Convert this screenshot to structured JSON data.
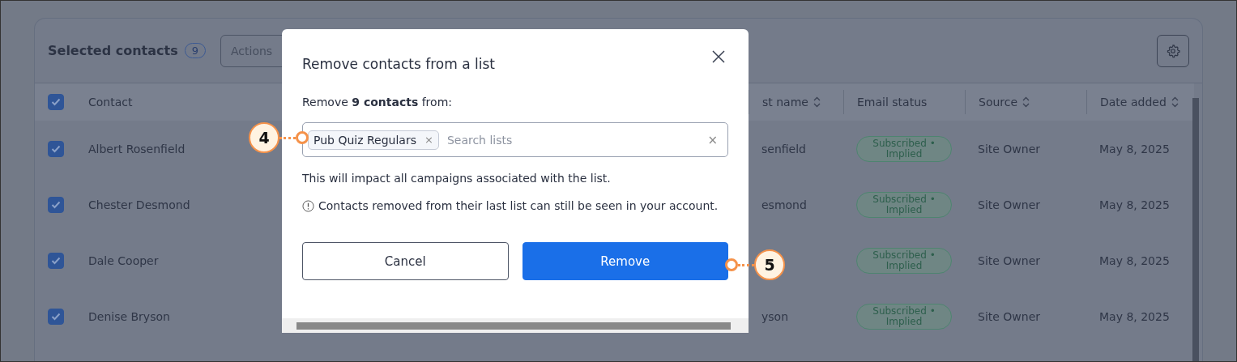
{
  "header": {
    "title": "Selected contacts",
    "count": "9",
    "actions_placeholder": "Actions"
  },
  "table": {
    "select_all_checked": true,
    "columns": [
      {
        "label": "Contact",
        "sortable": false
      },
      {
        "label": "st name",
        "sortable": true
      },
      {
        "label": "Email status",
        "sortable": false
      },
      {
        "label": "Source",
        "sortable": true
      },
      {
        "label": "Date added",
        "sortable": true
      }
    ],
    "rows": [
      {
        "checked": true,
        "contact": "Albert Rosenfield",
        "last_name": "senfield",
        "email_status": "Subscribed • Implied",
        "source": "Site Owner",
        "date_added": "May 8, 2025"
      },
      {
        "checked": true,
        "contact": "Chester Desmond",
        "last_name": "esmond",
        "email_status": "Subscribed • Implied",
        "source": "Site Owner",
        "date_added": "May 8, 2025"
      },
      {
        "checked": true,
        "contact": "Dale Cooper",
        "email_status": "Subscribed • Implied",
        "source": "Site Owner",
        "date_added": "May 8, 2025"
      },
      {
        "checked": true,
        "contact": "Denise Bryson",
        "last_name": "yson",
        "email_status": "Subscribed • Implied",
        "source": "Site Owner",
        "date_added": "May 8, 2025"
      }
    ]
  },
  "dialog": {
    "title": "Remove contacts from a list",
    "intro": "Remove **9 contacts** from:",
    "chips": [
      "Pub Quiz Regulars"
    ],
    "chip_remove": "×",
    "search_placeholder": "Search lists",
    "clear": "×",
    "impact_note": "This will impact all campaigns associated with the list.",
    "info_note": "Contacts removed from their last list can still be seen in your account.",
    "buttons": [
      {
        "label": "Cancel",
        "kind": "secondary"
      },
      {
        "label": "Remove",
        "kind": "primary"
      }
    ]
  },
  "callouts": [
    {
      "label": "4"
    },
    {
      "label": "5"
    }
  ]
}
